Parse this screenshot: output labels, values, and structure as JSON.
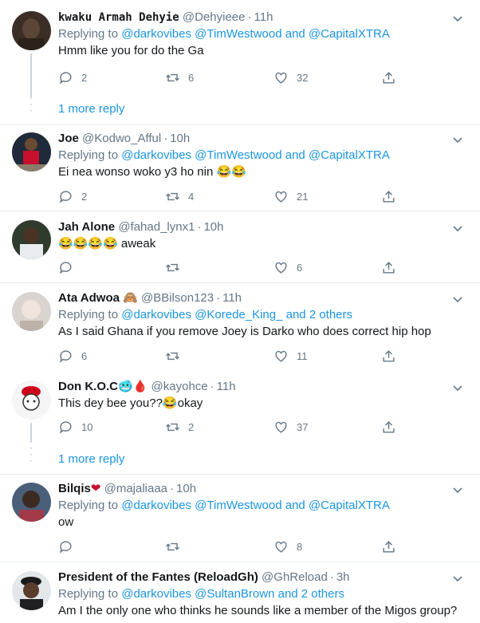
{
  "tweets": [
    {
      "display_name": "kwaku Armah Dehyie",
      "handle": "@Dehyieee",
      "time": "11h",
      "replying_prefix": "Replying to",
      "replying_to": "@darkovibes @TimWestwood and @CapitalXTRA",
      "text": "Hmm like you for do the Ga",
      "counts": {
        "reply": "2",
        "retweet": "6",
        "like": "32"
      }
    },
    {
      "display_name": "Joe",
      "handle": "@Kodwo_Afful",
      "time": "10h",
      "replying_prefix": "Replying to",
      "replying_to": "@darkovibes @TimWestwood and @CapitalXTRA",
      "text": "Ei nea wonso woko y3 ho nin",
      "emoji_suffix": "😂😂",
      "counts": {
        "reply": "2",
        "retweet": "4",
        "like": "21"
      }
    },
    {
      "display_name": "Jah Alone",
      "handle": "@fahad_lynx1",
      "time": "10h",
      "emoji_prefix": "😂😂😂😂",
      "text": " aweak",
      "counts": {
        "reply": "",
        "retweet": "",
        "like": "6"
      }
    },
    {
      "display_name": "Ata Adwoa",
      "name_emoji": "🙈",
      "handle": "@BBilson123",
      "time": "11h",
      "replying_prefix": "Replying to",
      "replying_to": "@darkovibes @Korede_King_ and 2 others",
      "text": "As I said Ghana if you remove Joey is Darko who does correct hip hop",
      "counts": {
        "reply": "6",
        "retweet": "",
        "like": "11"
      }
    },
    {
      "display_name": "Don K.O.C",
      "name_emoji": "🥶🩸",
      "handle": "@kayohce",
      "time": "11h",
      "text": "This dey bee you??",
      "emoji_mid": "😂",
      "text_after": "okay",
      "counts": {
        "reply": "10",
        "retweet": "2",
        "like": "37"
      }
    },
    {
      "display_name": "Bilqis",
      "name_emoji": "❤",
      "handle": "@majaliaaa",
      "time": "10h",
      "replying_prefix": "Replying to",
      "replying_to": "@darkovibes @TimWestwood and @CapitalXTRA",
      "text": "ow",
      "counts": {
        "reply": "",
        "retweet": "",
        "like": "8"
      }
    },
    {
      "display_name": "President of the Fantes (ReloadGh)",
      "handle": "@GhReload",
      "time": "3h",
      "replying_prefix": "Replying to",
      "replying_to": "@darkovibes @SultanBrown and 2 others",
      "text": "Am I the only one who thinks he sounds like a member of the Migos group?"
    }
  ],
  "more_replies": [
    "1 more reply",
    "1 more reply"
  ],
  "colors": {
    "link": "#1b95e0",
    "muted": "#657786",
    "text": "#14171a",
    "border": "#e6ecf0"
  }
}
